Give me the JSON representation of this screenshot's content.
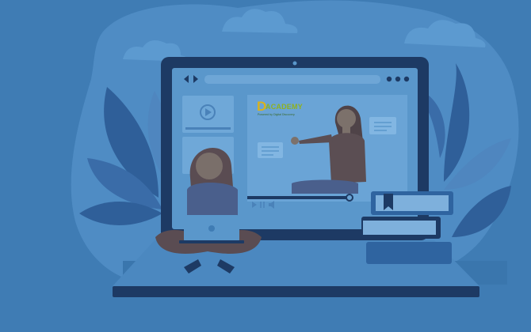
{
  "brand": {
    "logo_letter": "D",
    "logo_word": "ACADEMY",
    "tagline": "Powered by Digital Discovery"
  },
  "colors": {
    "background": "#3f7cb4",
    "blob": "#4f8cc4",
    "laptop_frame": "#1d3a64",
    "screen": "#5a97cb",
    "skin": "#7a6f6a",
    "hair": "#5a4c52",
    "shirt": "#4a5f8c",
    "leaf_dark": "#2f5f99",
    "leaf_light": "#4f86bf"
  },
  "icons": {
    "prev": "triangle-left-icon",
    "next": "triangle-right-icon",
    "play": "play-icon",
    "pause": "pause-icon",
    "volume": "volume-icon",
    "bookmark": "bookmark-icon"
  }
}
